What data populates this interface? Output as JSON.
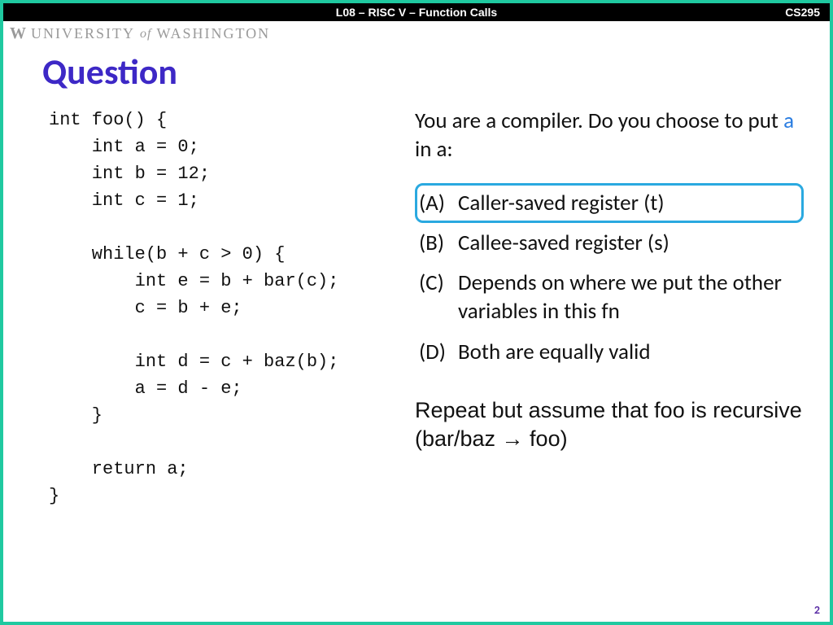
{
  "header": {
    "lecture": "L08 – RISC V – Function Calls",
    "course": "CS295"
  },
  "university": {
    "w": "W",
    "p1": "UNIVERSITY",
    "of": "of",
    "p2": "WASHINGTON"
  },
  "title": "Question",
  "code": "int foo() {\n    int a = 0;\n    int b = 12;\n    int c = 1;\n\n    while(b + c > 0) {\n        int e = b + bar(c);\n        c = b + e;\n\n        int d = c + baz(b);\n        a = d - e;\n    }\n\n    return a;\n}",
  "prompt": {
    "pre": "You are a compiler. Do you choose to put ",
    "var": "a",
    "post": " in a:"
  },
  "options": [
    {
      "label": "(A)",
      "text": "Caller-saved register (t)",
      "selected": true
    },
    {
      "label": "(B)",
      "text": "Callee-saved register (s)",
      "selected": false
    },
    {
      "label": "(C)",
      "text": "Depends on where we put the other variables in this fn",
      "selected": false
    },
    {
      "label": "(D)",
      "text": "Both are equally valid",
      "selected": false
    }
  ],
  "followup": "Repeat but assume that foo is recursive (bar/baz → foo)",
  "page": "2"
}
